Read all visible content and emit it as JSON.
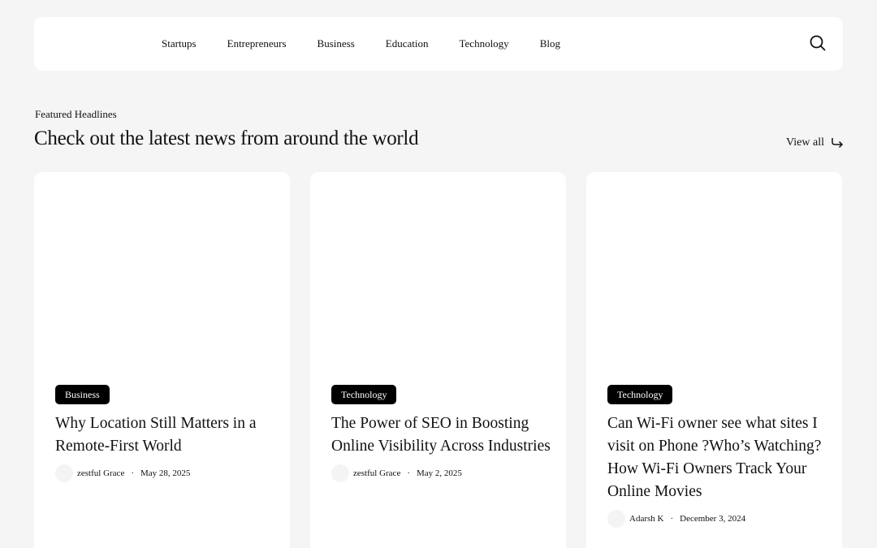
{
  "nav": {
    "items": [
      "Startups",
      "Entrepreneurs",
      "Business",
      "Education",
      "Technology",
      "Blog"
    ]
  },
  "section": {
    "eyebrow": "Featured Headlines",
    "title": "Check out the latest news from around the world",
    "view_all": "View all"
  },
  "cards": [
    {
      "category": "Business",
      "title": "Why Location Still Matters in a Remote-First World",
      "author": "zestful Grace",
      "separator": "·",
      "date": "May 28, 2025"
    },
    {
      "category": "Technology",
      "title": "The Power of SEO in Boosting Online Visibility Across Industries",
      "author": "zestful Grace",
      "separator": "·",
      "date": "May 2, 2025"
    },
    {
      "category": "Technology",
      "title": "Can Wi-Fi owner see what sites I visit on Phone ?Who’s Watching? How Wi-Fi Owners Track Your Online Movies",
      "author": "Adarsh K",
      "separator": "·",
      "date": "December 3, 2024"
    }
  ],
  "icons": {
    "search": "search-icon",
    "view_all": "arrow-turn-right-icon"
  }
}
